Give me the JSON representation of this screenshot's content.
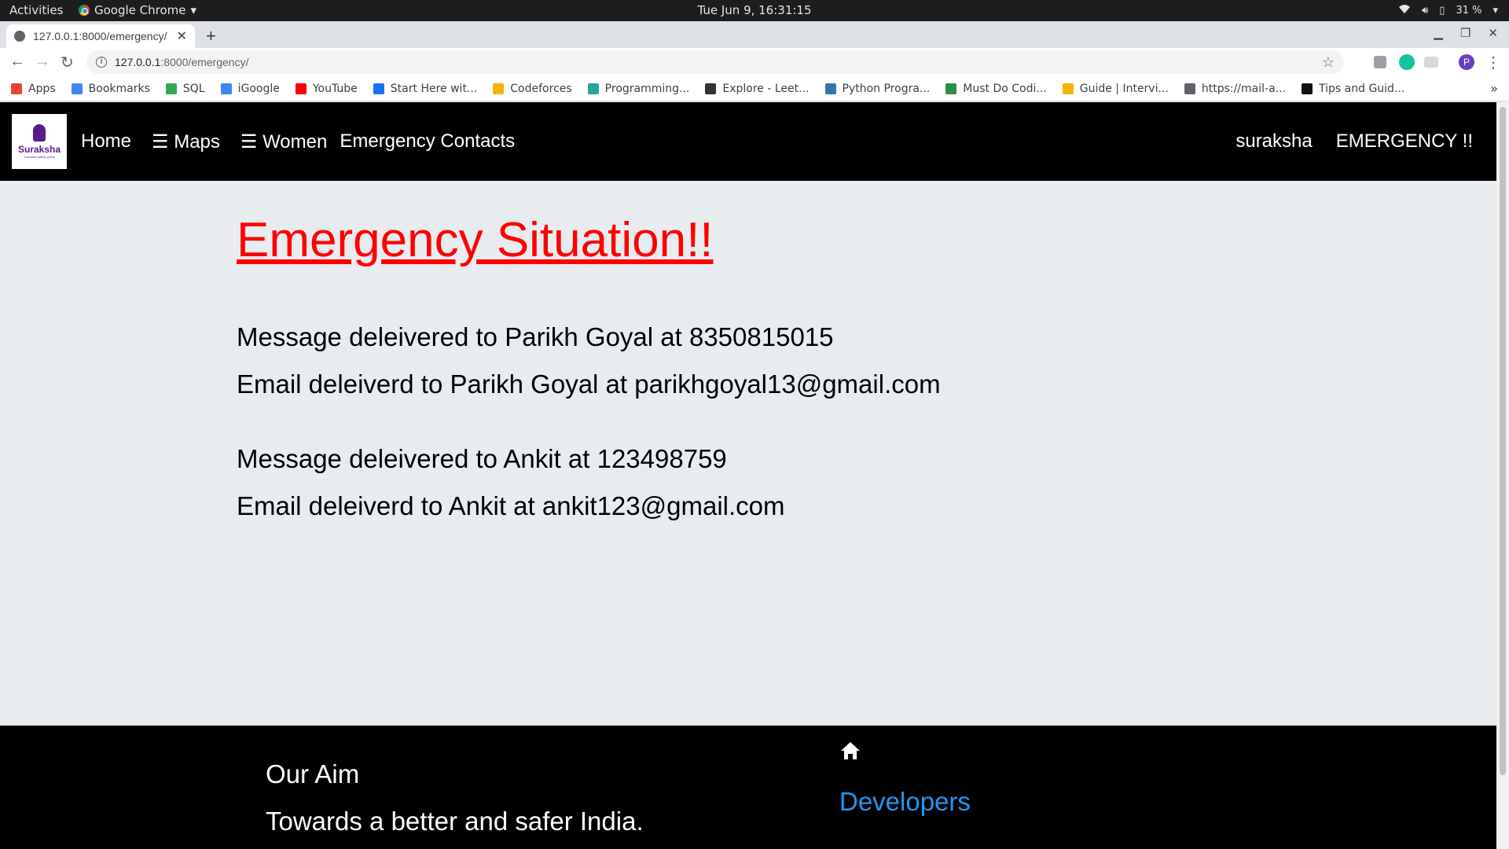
{
  "os": {
    "activities": "Activities",
    "app_name": "Google Chrome",
    "clock": "Tue Jun  9, 16:31:15",
    "battery": "31 %"
  },
  "browser": {
    "tab_title": "127.0.0.1:8000/emergency/",
    "url_host": "127.0.0.1",
    "url_path": ":8000/emergency/",
    "profile_initial": "P",
    "bookmarks": [
      {
        "label": "Apps",
        "color": "#ea4335"
      },
      {
        "label": "Bookmarks",
        "color": "#4285f4"
      },
      {
        "label": "SQL",
        "color": "#34a853"
      },
      {
        "label": "iGoogle",
        "color": "#4285f4"
      },
      {
        "label": "YouTube",
        "color": "#ff0000"
      },
      {
        "label": "Start Here wit...",
        "color": "#1a73e8"
      },
      {
        "label": "Codeforces",
        "color": "#f4b400"
      },
      {
        "label": "Programming...",
        "color": "#26a69a"
      },
      {
        "label": "Explore - Leet...",
        "color": "#333333"
      },
      {
        "label": "Python Progra...",
        "color": "#3776ab"
      },
      {
        "label": "Must Do Codi...",
        "color": "#2f8d46"
      },
      {
        "label": "Guide | Intervi...",
        "color": "#f4b400"
      },
      {
        "label": "https://mail-a...",
        "color": "#5f6368"
      },
      {
        "label": "Tips and Guid...",
        "color": "#111111"
      }
    ]
  },
  "site": {
    "logo_name": "Suraksha",
    "logo_tagline": "a women safety portal",
    "nav": {
      "home": "Home",
      "maps": "☰ Maps",
      "women": "☰ Women",
      "contacts": "Emergency Contacts",
      "user": "suraksha",
      "emergency": "EMERGENCY !!"
    },
    "heading": "Emergency Situation!!",
    "messages": [
      "Message deleivered to Parikh Goyal at 8350815015",
      "Email deleiverd to Parikh Goyal at parikhgoyal13@gmail.com",
      "Message deleivered to Ankit at 123498759",
      "Email deleiverd to Ankit at ankit123@gmail.com"
    ],
    "footer": {
      "aim_title": "Our Aim",
      "aim_text": "Towards a better and safer India.",
      "developers": "Developers"
    }
  }
}
